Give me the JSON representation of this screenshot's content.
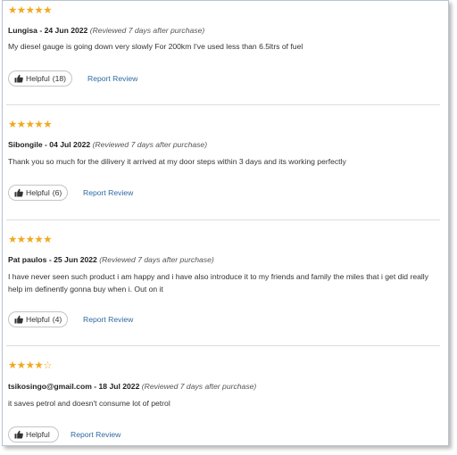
{
  "reviews": [
    {
      "stars_filled": "★★★★★",
      "stars_empty": "",
      "rating": 5,
      "author": "Lungisa",
      "date": " - 24 Jun 2022",
      "note": "(Reviewed 7 days after purchase)",
      "text": "My diesel gauge is going down very slowly For 200km I've used less than 6.5ltrs of fuel",
      "helpful_label": "Helpful",
      "helpful_count": "(18)",
      "report_label": "Report Review"
    },
    {
      "stars_filled": "★★★★★",
      "stars_empty": "",
      "rating": 5,
      "author": "Sibongile",
      "date": " - 04 Jul 2022",
      "note": "(Reviewed 7 days after purchase)",
      "text": "Thank you so much for the dilivery it arrived at my door steps within 3 days and its working perfectly",
      "helpful_label": "Helpful",
      "helpful_count": "(6)",
      "report_label": "Report Review"
    },
    {
      "stars_filled": "★★★★★",
      "stars_empty": "",
      "rating": 5,
      "author": "Pat paulos",
      "date": " - 25 Jun 2022",
      "note": "(Reviewed 7 days after purchase)",
      "text": "I have never seen such product i am happy and i have also introduce it to my friends and family the miles that i get did really help im definently gonna buy when i. Out on it",
      "helpful_label": "Helpful",
      "helpful_count": "(4)",
      "report_label": "Report Review"
    },
    {
      "stars_filled": "★★★★",
      "stars_empty": "☆",
      "rating": 4,
      "author": "tsikosingo@gmail.com",
      "date": " - 18 Jul 2022",
      "note": "(Reviewed 7 days after purchase)",
      "text": "it saves petrol and doesn't consume lot of petrol",
      "helpful_label": "Helpful",
      "helpful_count": "",
      "report_label": "Report Review"
    }
  ],
  "colors": {
    "star": "#f0a920",
    "link": "#2f6aa3",
    "divider": "#dcdcdc"
  },
  "icons": {
    "helpful": "thumbs-up-icon",
    "star": "star-icon"
  }
}
